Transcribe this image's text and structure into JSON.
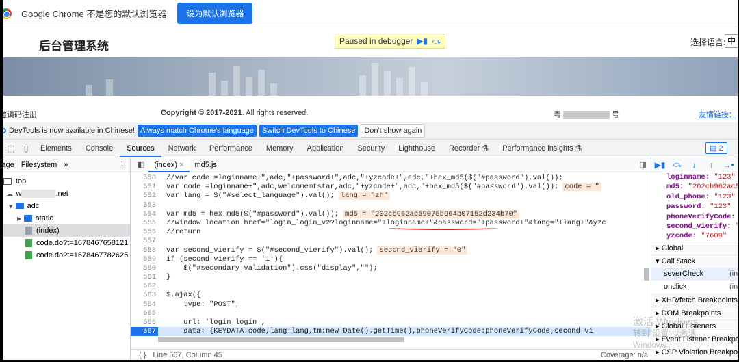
{
  "chrome": {
    "message": "Google Chrome 不是您的默认浏览器",
    "set_default": "设为默认浏览器"
  },
  "site": {
    "title": "后台管理系统",
    "paused": "Paused in debugger",
    "lang_label": "选择语言:",
    "lang_value": "中",
    "reg_link": "邀请码注册",
    "copyright_bold": "Copyright © 2017-2021",
    "copyright_rest": ". All rights reserved.",
    "icp_prefix": "粤",
    "icp_suffix": "号",
    "friend_link": "友情链接："
  },
  "notice": {
    "text": "DevTools is now available in Chinese!",
    "btn_match": "Always match Chrome's language",
    "btn_switch": "Switch DevTools to Chinese",
    "btn_dismiss": "Don't show again"
  },
  "devtools": {
    "tabs": [
      "Elements",
      "Console",
      "Sources",
      "Network",
      "Performance",
      "Memory",
      "Application",
      "Security",
      "Lighthouse",
      "Recorder ⚗",
      "Performance insights ⚗"
    ],
    "active_tab": "Sources",
    "issues_count": "2"
  },
  "navigator": {
    "tabs": [
      "Page",
      "Filesystem",
      "»"
    ],
    "tree": [
      {
        "label": "top",
        "type": "frame"
      },
      {
        "label": ".net",
        "type": "origin",
        "prefix": "w"
      },
      {
        "label": "adc",
        "type": "folder"
      },
      {
        "label": "static",
        "type": "folder"
      },
      {
        "label": "(index)",
        "type": "file-selected"
      },
      {
        "label": "code.do?t=1678467658121",
        "type": "file"
      },
      {
        "label": "code.do?t=1678467782625",
        "type": "file"
      }
    ]
  },
  "editor": {
    "tabs": [
      "(index)",
      "md5.js"
    ],
    "lines": [
      {
        "n": "550",
        "code": "//var code =loginname+\",adc,\"+password+\",adc,\"+yzcode+\",adc,\"+hex_md5($(\"#password\").val());",
        "hint": ""
      },
      {
        "n": "551",
        "code": "var code =loginname+\",adc,welcomemtstar,adc,\"+yzcode+\",adc,\"+hex_md5($(\"#password\").val());",
        "hint": "code = \""
      },
      {
        "n": "552",
        "code": "var lang = $(\"#select_language\").val();",
        "hint": "lang = \"zh\""
      },
      {
        "n": "553",
        "code": "",
        "hint": ""
      },
      {
        "n": "554",
        "code": "var md5 = hex_md5($(\"#password\").val());",
        "hint": "md5 = \"202cb962ac59075b964b07152d234b70\""
      },
      {
        "n": "555",
        "code": "//window.location.href=\"login_login_v2?loginname=\"+loginname+\"&password=\"+password+\"&lang=\"+lang+\"&yzc",
        "hint": ""
      },
      {
        "n": "556",
        "code": "//return",
        "hint": ""
      },
      {
        "n": "557",
        "code": "",
        "hint": ""
      },
      {
        "n": "558",
        "code": "var second_vierify = $(\"#second_vierify\").val();",
        "hint": "second_vierify = \"0\""
      },
      {
        "n": "559",
        "code": "if (second_vierify == '1'){",
        "hint": ""
      },
      {
        "n": "560",
        "code": "    $(\"#secondary_validation\").css(\"display\",\"\");",
        "hint": ""
      },
      {
        "n": "561",
        "code": "}",
        "hint": ""
      },
      {
        "n": "562",
        "code": "",
        "hint": ""
      },
      {
        "n": "563",
        "code": "$.ajax({",
        "hint": ""
      },
      {
        "n": "564",
        "code": "    type: \"POST\",",
        "hint": ""
      },
      {
        "n": "565",
        "code": "",
        "hint": ""
      },
      {
        "n": "566",
        "code": "    url: 'login_login',",
        "hint": ""
      },
      {
        "n": "567",
        "code": "    data: {KEYDATA:code,lang:lang,tm:new Date().getTime(),phoneVerifyCode:phoneVerifyCode,second_vi",
        "hint": ""
      }
    ],
    "current_line": "567",
    "status": "Line 567, Column 45",
    "coverage": "Coverage: n/a"
  },
  "debugger": {
    "scope": [
      {
        "k": "loginname",
        "v": "\"123\""
      },
      {
        "k": "md5",
        "v": "\"202cb962ac5"
      },
      {
        "k": "old_phone",
        "v": "\"123\""
      },
      {
        "k": "password",
        "v": "\"123\""
      },
      {
        "k": "phoneVerifyCode",
        "v": ""
      },
      {
        "k": "second_vierify",
        "v": "\""
      },
      {
        "k": "yzcode",
        "v": "\"7609\""
      }
    ],
    "global": "Global",
    "call_stack": "Call Stack",
    "frames": [
      {
        "name": "severCheck",
        "loc": "(in"
      },
      {
        "name": "onclick",
        "loc": "(in"
      }
    ],
    "sections": [
      "XHR/fetch Breakpoints",
      "DOM Breakpoints",
      "Global Listeners",
      "Event Listener Breakpoints",
      "CSP Violation Breakpoints"
    ]
  },
  "watermark": {
    "line1": "激活 Windows",
    "line2": "转到\"设置\"以激活 Windows。"
  }
}
